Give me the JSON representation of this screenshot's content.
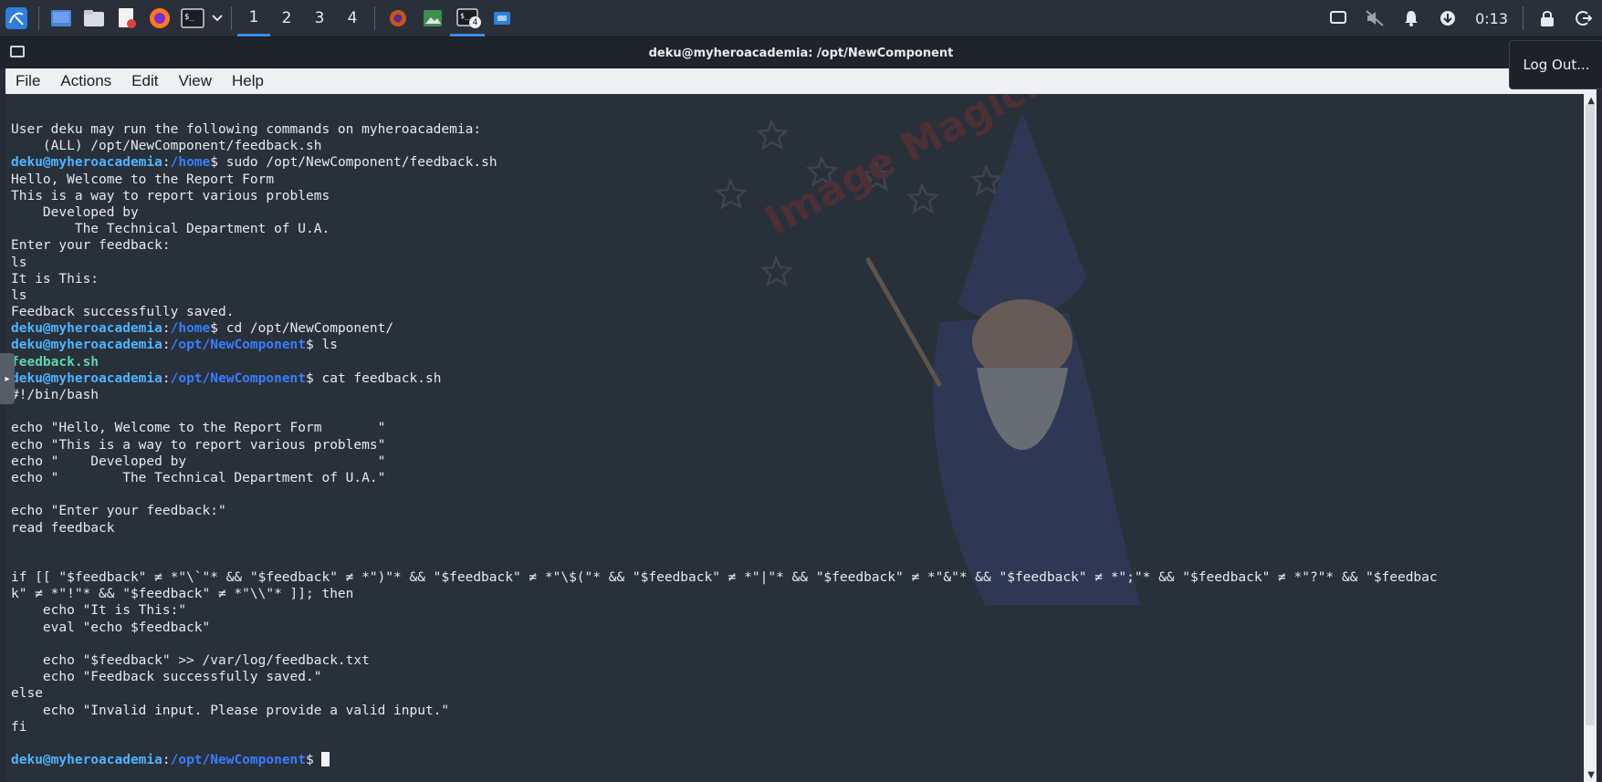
{
  "panel": {
    "workspaces": [
      "1",
      "2",
      "3",
      "4"
    ],
    "active_workspace": "1",
    "task_badge": "4",
    "clock": "0:13",
    "launchers": [
      "kali-menu-icon",
      "desktop-icon",
      "file-manager-icon",
      "text-editor-icon",
      "firefox-icon",
      "terminal-icon"
    ],
    "tasks": [
      "firefox-task-icon",
      "image-viewer-task-icon",
      "terminal-task-icon",
      "screenshot-task-icon"
    ]
  },
  "window": {
    "title": "deku@myheroacademia: /opt/NewComponent",
    "menus": [
      "File",
      "Actions",
      "Edit",
      "View",
      "Help"
    ]
  },
  "logout_tooltip": "Log Out...",
  "terminal": {
    "lines": [
      {
        "t": "User deku may run the following commands on myheroacademia:"
      },
      {
        "t": "    (ALL) /opt/NewComponent/feedback.sh"
      },
      {
        "user": "deku@myheroacademia",
        "path": "/home",
        "t": "sudo /opt/NewComponent/feedback.sh"
      },
      {
        "t": "Hello, Welcome to the Report Form"
      },
      {
        "t": "This is a way to report various problems"
      },
      {
        "t": "    Developed by"
      },
      {
        "t": "        The Technical Department of U.A."
      },
      {
        "t": "Enter your feedback:"
      },
      {
        "t": "ls"
      },
      {
        "t": "It is This:"
      },
      {
        "t": "ls"
      },
      {
        "t": "Feedback successfully saved."
      },
      {
        "user": "deku@myheroacademia",
        "path": "/home",
        "t": "cd /opt/NewComponent/"
      },
      {
        "user": "deku@myheroacademia",
        "path": "/opt/NewComponent",
        "t": "ls"
      },
      {
        "t": "feedback.sh",
        "color": "#5fd7a7"
      },
      {
        "user": "deku@myheroacademia",
        "path": "/opt/NewComponent",
        "t": "cat feedback.sh"
      },
      {
        "t": "#!/bin/bash"
      },
      {
        "t": ""
      },
      {
        "t": "echo \"Hello, Welcome to the Report Form       \""
      },
      {
        "t": "echo \"This is a way to report various problems\""
      },
      {
        "t": "echo \"    Developed by                        \""
      },
      {
        "t": "echo \"        The Technical Department of U.A.\""
      },
      {
        "t": ""
      },
      {
        "t": "echo \"Enter your feedback:\""
      },
      {
        "t": "read feedback"
      },
      {
        "t": ""
      },
      {
        "t": ""
      },
      {
        "t": "if [[ \"$feedback\" ≠ *\"\\`\"* && \"$feedback\" ≠ *\")\"* && \"$feedback\" ≠ *\"\\$(\"* && \"$feedback\" ≠ *\"|\"* && \"$feedback\" ≠ *\"&\"* && \"$feedback\" ≠ *\";\"* && \"$feedback\" ≠ *\"?\"* && \"$feedbac"
      },
      {
        "t": "k\" ≠ *\"!\"* && \"$feedback\" ≠ *\"\\\\\"* ]]; then"
      },
      {
        "t": "    echo \"It is This:\""
      },
      {
        "t": "    eval \"echo $feedback\""
      },
      {
        "t": ""
      },
      {
        "t": "    echo \"$feedback\" >> /var/log/feedback.txt"
      },
      {
        "t": "    echo \"Feedback successfully saved.\""
      },
      {
        "t": "else"
      },
      {
        "t": "    echo \"Invalid input. Please provide a valid input.\""
      },
      {
        "t": "fi"
      },
      {
        "t": ""
      },
      {
        "user": "deku@myheroacademia",
        "path": "/opt/NewComponent",
        "t": "",
        "cursor": true
      }
    ]
  },
  "colors": {
    "prompt_user": "#4fb4ff",
    "prompt_path": "#3a7dff",
    "terminal_bg": "#28303a",
    "accent": "#3b8ee8"
  }
}
